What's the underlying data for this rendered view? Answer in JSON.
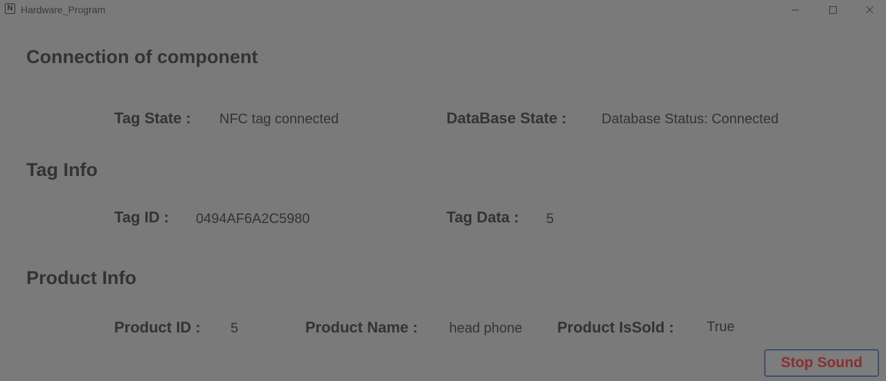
{
  "window": {
    "title": "Hardware_Program",
    "icon": "nfc-app-icon",
    "icon_glyph": "N",
    "controls": [
      "minimize-icon",
      "maximize-icon",
      "close-icon"
    ]
  },
  "sections": {
    "connection": {
      "title": "Connection of component",
      "tag_state_label": "Tag State :",
      "tag_state_value": "NFC tag connected",
      "db_state_label": "DataBase State :",
      "db_state_value": "Database Status: Connected"
    },
    "tag_info": {
      "title": "Tag Info",
      "tag_id_label": "Tag ID :",
      "tag_id_value": "0494AF6A2C5980",
      "tag_data_label": "Tag Data :",
      "tag_data_value": "5"
    },
    "product_info": {
      "title": "Product Info",
      "product_id_label": "Product ID :",
      "product_id_value": "5",
      "product_name_label": "Product Name :",
      "product_name_value": "head phone",
      "product_issold_label": "Product IsSold :",
      "product_issold_value": "True"
    }
  },
  "actions": {
    "stop_sound_label": "Stop Sound"
  },
  "colors": {
    "background": "#7a7a7a",
    "text": "#333333",
    "stop_button_text": "#8a2f31",
    "stop_button_border": "#3d4f6e"
  }
}
